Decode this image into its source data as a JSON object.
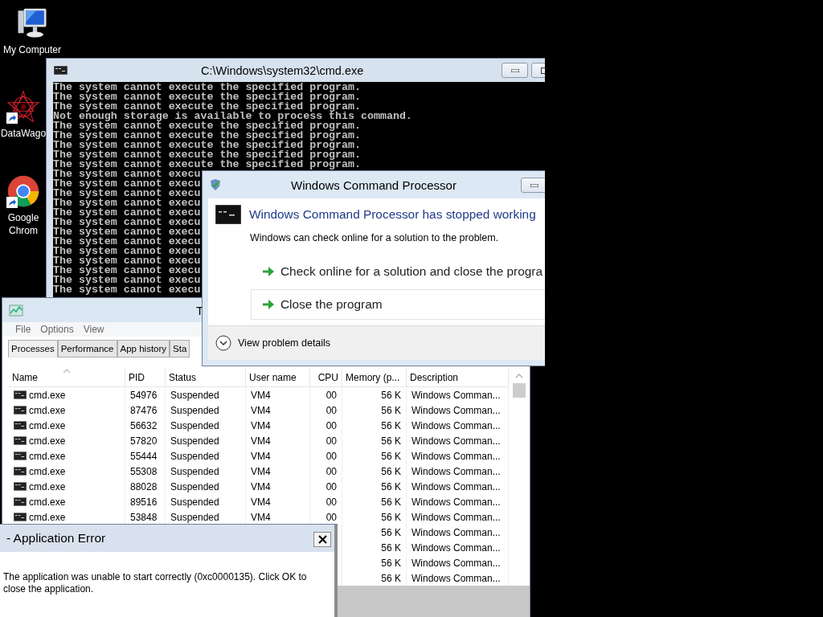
{
  "desktop_icons": [
    {
      "kind": "computer",
      "label_lines": [
        "My Computer"
      ],
      "shortcut": false
    },
    {
      "kind": "star",
      "label_lines": [
        "DataWago"
      ],
      "shortcut": true
    },
    {
      "kind": "browser",
      "label_lines": [
        "Google",
        "Chrom"
      ],
      "shortcut": true
    }
  ],
  "cmd_window": {
    "title": "C:\\Windows\\system32\\cmd.exe",
    "lines": [
      "The system cannot execute the specified program.",
      "The system cannot execute the specified program.",
      "The system cannot execute the specified program.",
      "Not enough storage is available to process this command.",
      "The system cannot execute the specified program.",
      "The system cannot execute the specified program.",
      "The system cannot execute the specified program.",
      "The system cannot execute the specified program.",
      "The system cannot execute the specified program.",
      "The system cannot execu",
      "The system cannot execu",
      "The system cannot execu",
      "The system cannot execu",
      "The system cannot execu",
      "The system cannot execu",
      "The system cannot execu",
      "The system cannot execu",
      "The system cannot execu",
      "The system cannot execu",
      "The system cannot execu",
      "The system cannot execu",
      "The system cannot execu"
    ]
  },
  "task_manager": {
    "title": "T",
    "menu": [
      "File",
      "Options",
      "View"
    ],
    "tabs": [
      {
        "label": "Processes",
        "selected": true
      },
      {
        "label": "Performance",
        "selected": false
      },
      {
        "label": "App history",
        "selected": false
      },
      {
        "label": "Sta",
        "selected": false
      }
    ],
    "columns": [
      {
        "label": "Name",
        "sorted": true
      },
      {
        "label": "PID",
        "sorted": false
      },
      {
        "label": "Status",
        "sorted": false
      },
      {
        "label": "User name",
        "sorted": false
      },
      {
        "label": "CPU",
        "sorted": false
      },
      {
        "label": "Memory (p...",
        "sorted": false
      },
      {
        "label": "Description",
        "sorted": false
      }
    ],
    "rows": [
      {
        "name": "cmd.exe",
        "pid": "54976",
        "status": "Suspended",
        "user": "VM4",
        "cpu": "00",
        "memory": "56 K",
        "description": "Windows Comman..."
      },
      {
        "name": "cmd.exe",
        "pid": "87476",
        "status": "Suspended",
        "user": "VM4",
        "cpu": "00",
        "memory": "56 K",
        "description": "Windows Comman..."
      },
      {
        "name": "cmd.exe",
        "pid": "56632",
        "status": "Suspended",
        "user": "VM4",
        "cpu": "00",
        "memory": "56 K",
        "description": "Windows Comman..."
      },
      {
        "name": "cmd.exe",
        "pid": "57820",
        "status": "Suspended",
        "user": "VM4",
        "cpu": "00",
        "memory": "56 K",
        "description": "Windows Comman..."
      },
      {
        "name": "cmd.exe",
        "pid": "55444",
        "status": "Suspended",
        "user": "VM4",
        "cpu": "00",
        "memory": "56 K",
        "description": "Windows Comman..."
      },
      {
        "name": "cmd.exe",
        "pid": "55308",
        "status": "Suspended",
        "user": "VM4",
        "cpu": "00",
        "memory": "56 K",
        "description": "Windows Comman..."
      },
      {
        "name": "cmd.exe",
        "pid": "88028",
        "status": "Suspended",
        "user": "VM4",
        "cpu": "00",
        "memory": "56 K",
        "description": "Windows Comman..."
      },
      {
        "name": "cmd.exe",
        "pid": "89516",
        "status": "Suspended",
        "user": "VM4",
        "cpu": "00",
        "memory": "56 K",
        "description": "Windows Comman..."
      },
      {
        "name": "cmd.exe",
        "pid": "53848",
        "status": "Suspended",
        "user": "VM4",
        "cpu": "00",
        "memory": "56 K",
        "description": "Windows Comman..."
      },
      {
        "memory": "56 K",
        "description": "Windows Comman..."
      },
      {
        "memory": "56 K",
        "description": "Windows Comman..."
      },
      {
        "memory": "56 K",
        "description": "Windows Comman..."
      },
      {
        "memory": "56 K",
        "description": "Windows Comman..."
      }
    ]
  },
  "crash_dialog": {
    "title": "Windows Command Processor",
    "heading": "Windows Command Processor has stopped working",
    "message": "Windows can check online for a solution to the problem.",
    "options": [
      {
        "label": "Check online for a solution and close the progra",
        "highlighted": false
      },
      {
        "label": "Close the program",
        "highlighted": true
      }
    ],
    "details_toggle": "View problem details"
  },
  "app_error": {
    "title": "- Application Error",
    "message": "The application was unable to start correctly (0xc0000135). Click OK to close the application."
  }
}
